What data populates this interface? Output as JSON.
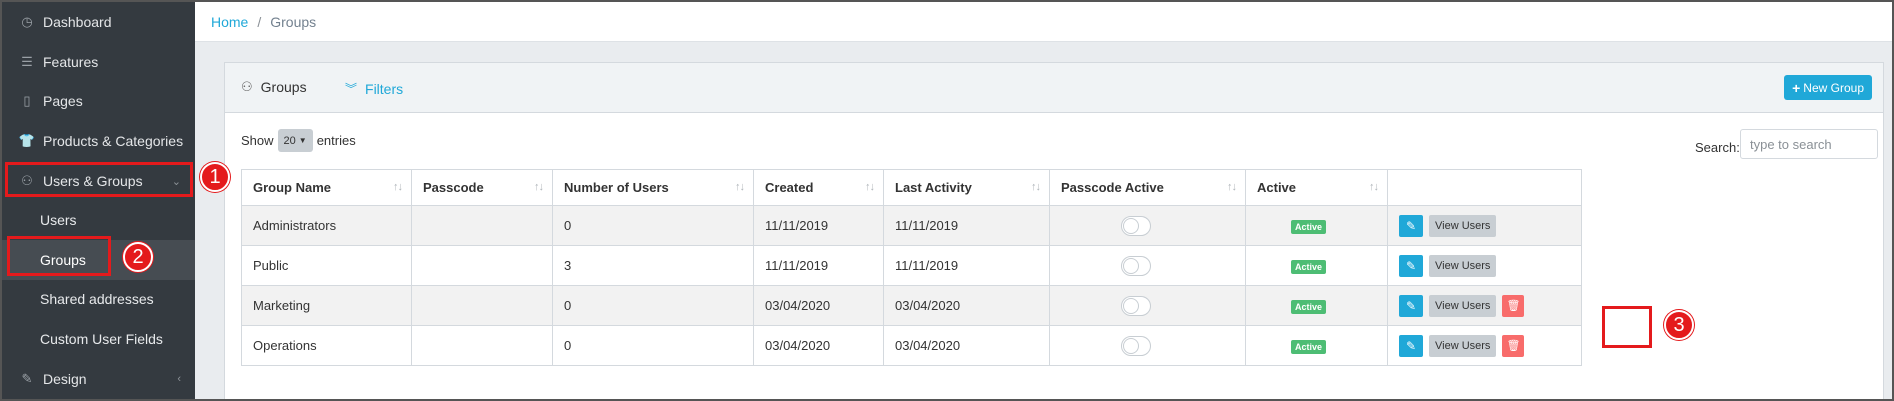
{
  "sidebar": {
    "items": [
      {
        "label": "Dashboard",
        "icon": "dashboard-icon"
      },
      {
        "label": "Features",
        "icon": "list-icon"
      },
      {
        "label": "Pages",
        "icon": "file-icon"
      },
      {
        "label": "Products & Categories",
        "icon": "shirt-icon"
      },
      {
        "label": "Users & Groups",
        "icon": "user-icon"
      },
      {
        "label": "Design",
        "icon": "brush-icon"
      }
    ],
    "subitems": [
      {
        "label": "Users"
      },
      {
        "label": "Groups"
      },
      {
        "label": "Shared addresses"
      },
      {
        "label": "Custom User Fields"
      }
    ]
  },
  "breadcrumb": {
    "home": "Home",
    "separator": "/",
    "current": "Groups"
  },
  "card": {
    "title": "Groups",
    "filters": "Filters",
    "new_button": "New Group"
  },
  "table_controls": {
    "show": "Show",
    "entries_value": "20",
    "entries": "entries",
    "search_label": "Search:",
    "search_placeholder": "type to search"
  },
  "table": {
    "columns": [
      "Group Name",
      "Passcode",
      "Number of Users",
      "Created",
      "Last Activity",
      "Passcode Active",
      "Active",
      ""
    ],
    "rows": [
      {
        "name": "Administrators",
        "passcode": "",
        "users": "0",
        "created": "11/11/2019",
        "last_activity": "11/11/2019",
        "passcode_active": false,
        "active": "Active",
        "view": "View Users",
        "deletable": false
      },
      {
        "name": "Public",
        "passcode": "",
        "users": "3",
        "created": "11/11/2019",
        "last_activity": "11/11/2019",
        "passcode_active": false,
        "active": "Active",
        "view": "View Users",
        "deletable": false
      },
      {
        "name": "Marketing",
        "passcode": "",
        "users": "0",
        "created": "03/04/2020",
        "last_activity": "03/04/2020",
        "passcode_active": false,
        "active": "Active",
        "view": "View Users",
        "deletable": true
      },
      {
        "name": "Operations",
        "passcode": "",
        "users": "0",
        "created": "03/04/2020",
        "last_activity": "03/04/2020",
        "passcode_active": false,
        "active": "Active",
        "view": "View Users",
        "deletable": true
      }
    ]
  },
  "annotations": [
    "1",
    "2",
    "3"
  ],
  "colors": {
    "accent": "#20a8d8",
    "sidebar": "#343a40",
    "success": "#4dbd74",
    "danger": "#f86c6b",
    "callout": "#e41a1c"
  }
}
